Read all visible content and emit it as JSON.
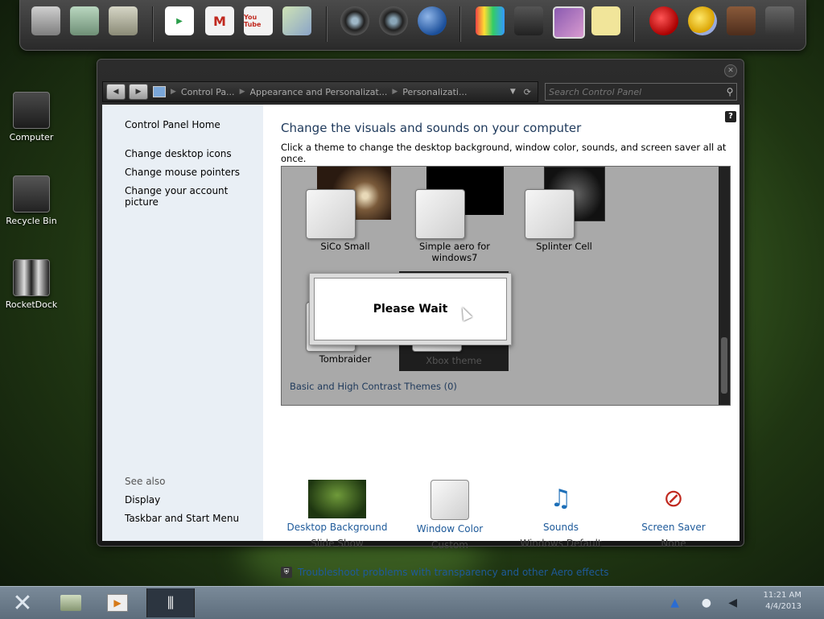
{
  "dock": {
    "icons": [
      {
        "name": "drive-icon",
        "label": ""
      },
      {
        "name": "network-drive-icon",
        "label": ""
      },
      {
        "name": "folder-icon",
        "label": ""
      },
      {
        "name": "play-store-icon",
        "label": "▶"
      },
      {
        "name": "gmail-icon",
        "label": "M"
      },
      {
        "name": "youtube-icon",
        "label": "You Tube"
      },
      {
        "name": "maps-icon",
        "label": ""
      },
      {
        "name": "speaker-icon",
        "label": ""
      },
      {
        "name": "speaker-2-icon",
        "label": ""
      },
      {
        "name": "globe-icon",
        "label": ""
      },
      {
        "name": "colors-icon",
        "label": ""
      },
      {
        "name": "calculator-icon",
        "label": ""
      },
      {
        "name": "photo-icon",
        "label": ""
      },
      {
        "name": "notes-icon",
        "label": ""
      },
      {
        "name": "angry-birds-icon",
        "label": ""
      },
      {
        "name": "weather-icon",
        "label": ""
      },
      {
        "name": "android-icon",
        "label": ""
      },
      {
        "name": "trash-icon",
        "label": ""
      }
    ]
  },
  "desktop": {
    "items": [
      {
        "label": "Computer"
      },
      {
        "label": "Recycle Bin"
      },
      {
        "label": "RocketDock"
      }
    ]
  },
  "window": {
    "breadcrumbs": [
      "Control Pa...",
      "Appearance and Personalizat...",
      "Personalizati..."
    ],
    "search_placeholder": "Search Control Panel",
    "help_label": "?",
    "left": {
      "home": "Control Panel Home",
      "links": [
        "Change desktop icons",
        "Change mouse pointers",
        "Change your account picture"
      ],
      "see_also_heading": "See also",
      "see_also": [
        "Display",
        "Taskbar and Start Menu"
      ]
    },
    "main": {
      "title": "Change the visuals and sounds on your computer",
      "subtitle": "Click a theme to change the desktop background, window color, sounds, and screen saver all at once.",
      "themes": [
        {
          "label": "SiCo Small"
        },
        {
          "label": "Simple aero for windows7"
        },
        {
          "label": "Splinter Cell"
        },
        {
          "label": "Tombraider"
        },
        {
          "label": "Xbox theme"
        }
      ],
      "basic_contrast": "Basic and High Contrast Themes (0)",
      "dialog": "Please Wait",
      "options": [
        {
          "label": "Desktop Background",
          "value": "Slide Show"
        },
        {
          "label": "Window Color",
          "value": "Custom"
        },
        {
          "label": "Sounds",
          "value": "Windows Default"
        },
        {
          "label": "Screen Saver",
          "value": "None"
        }
      ],
      "troubleshoot": "Troubleshoot problems with transparency and other Aero effects"
    }
  },
  "taskbar": {
    "clock_time": "11:21 AM",
    "clock_date": "4/4/2013"
  }
}
